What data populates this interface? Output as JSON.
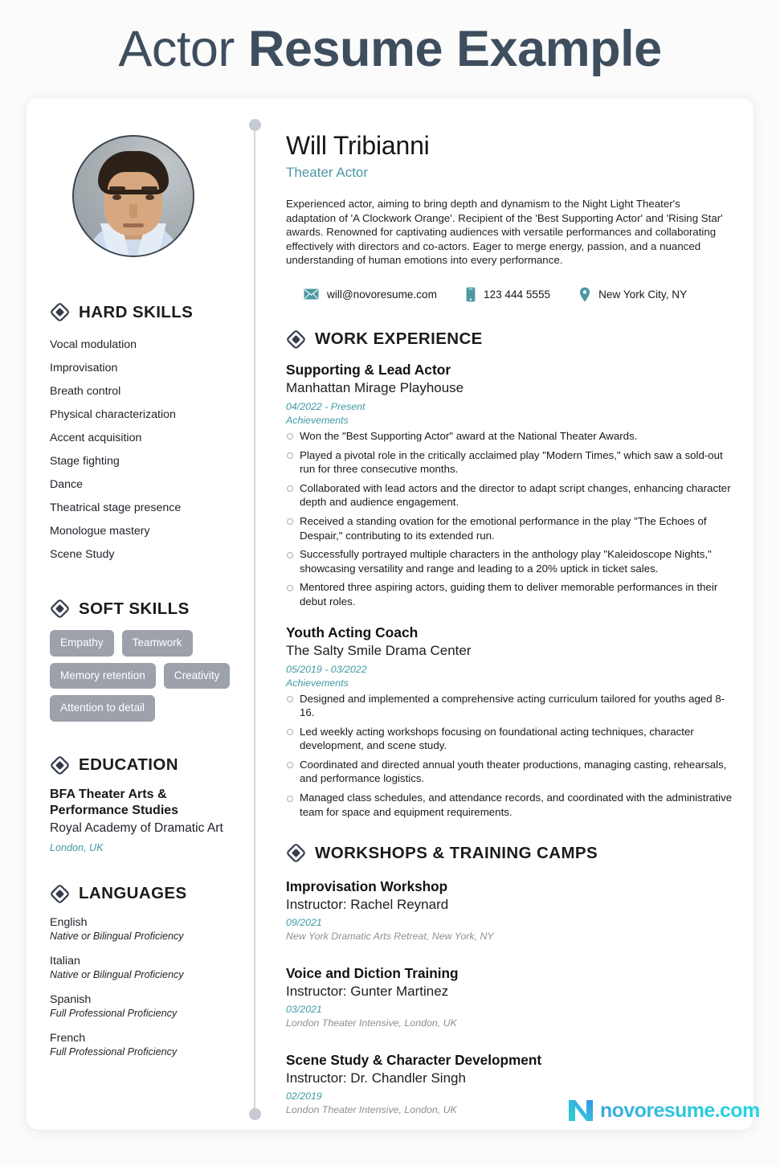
{
  "header": {
    "title_light": "Actor",
    "title_bold": "Resume Example"
  },
  "profile": {
    "name": "Will Tribianni",
    "role": "Theater Actor",
    "summary": "Experienced actor, aiming to bring depth and dynamism to the Night Light Theater's adaptation of 'A Clockwork Orange'. Recipient of the 'Best Supporting Actor' and 'Rising Star' awards. Renowned for captivating audiences with versatile performances and collaborating effectively with directors and co-actors. Eager to merge energy, passion, and a nuanced understanding of human emotions into every performance.",
    "photo_alt": "portrait-photo"
  },
  "contacts": [
    {
      "icon": "envelope-icon",
      "text": "will@novoresume.com"
    },
    {
      "icon": "phone-icon",
      "text": "123 444 5555"
    },
    {
      "icon": "location-pin-icon",
      "text": "New York City, NY"
    }
  ],
  "sidebar": {
    "hard_skills": {
      "heading": "HARD SKILLS",
      "items": [
        "Vocal modulation",
        "Improvisation",
        "Breath control",
        "Physical characterization",
        "Accent acquisition",
        "Stage fighting",
        "Dance",
        "Theatrical stage presence",
        "Monologue mastery",
        "Scene Study"
      ]
    },
    "soft_skills": {
      "heading": "SOFT SKILLS",
      "items": [
        "Empathy",
        "Teamwork",
        "Memory retention",
        "Creativity",
        "Attention to detail"
      ]
    },
    "education": {
      "heading": "EDUCATION",
      "degree": "BFA Theater Arts & Performance Studies",
      "school": "Royal Academy of Dramatic Art",
      "location": "London, UK"
    },
    "languages": {
      "heading": "LANGUAGES",
      "items": [
        {
          "name": "English",
          "level": "Native or Bilingual Proficiency"
        },
        {
          "name": "Italian",
          "level": "Native or Bilingual Proficiency"
        },
        {
          "name": "Spanish",
          "level": "Full Professional Proficiency"
        },
        {
          "name": "French",
          "level": "Full Professional Proficiency"
        }
      ]
    }
  },
  "work": {
    "heading": "WORK EXPERIENCE",
    "achievements_label": "Achievements",
    "jobs": [
      {
        "title": "Supporting & Lead Actor",
        "org": "Manhattan Mirage Playhouse",
        "date": "04/2022 - Present",
        "bullets": [
          "Won the \"Best Supporting Actor\" award at the National Theater Awards.",
          "Played a pivotal role in the critically acclaimed play \"Modern Times,\" which saw a sold-out run for three consecutive months.",
          "Collaborated with lead actors and the director to adapt script changes, enhancing character depth and audience engagement.",
          "Received a standing ovation for the emotional performance in the play \"The Echoes of Despair,\" contributing to its extended run.",
          "Successfully portrayed multiple characters in the anthology play \"Kaleidoscope Nights,\" showcasing versatility and range and leading to a 20% uptick in ticket sales.",
          "Mentored three aspiring actors, guiding them to deliver memorable performances in their debut roles."
        ]
      },
      {
        "title": "Youth Acting Coach",
        "org": "The Salty Smile Drama Center",
        "date": "05/2019 - 03/2022",
        "bullets": [
          "Designed and implemented a comprehensive acting curriculum tailored for youths aged 8-16.",
          "Led weekly acting workshops focusing on foundational acting techniques, character development, and scene study.",
          "Coordinated and directed annual youth theater productions, managing casting, rehearsals, and performance logistics.",
          "Managed class schedules, and attendance records, and coordinated with the administrative team for space and equipment requirements."
        ]
      }
    ]
  },
  "workshops": {
    "heading": "WORKSHOPS & TRAINING CAMPS",
    "items": [
      {
        "title": "Improvisation Workshop",
        "instructor": "Instructor: Rachel Reynard",
        "date": "09/2021",
        "venue": "New York Dramatic Arts Retreat, New York, NY"
      },
      {
        "title": "Voice and Diction Training",
        "instructor": "Instructor: Gunter Martinez",
        "date": "03/2021",
        "venue": "London Theater Intensive, London, UK"
      },
      {
        "title": "Scene Study & Character Development",
        "instructor": "Instructor: Dr. Chandler Singh",
        "date": "02/2019",
        "venue": "London Theater Intensive, London, UK"
      }
    ]
  },
  "branding": {
    "logo_text": "novoresume.com",
    "logo_mark": "N"
  },
  "colors": {
    "title": "#3e4e5e",
    "teal": "#4d98a3",
    "accent_italic": "#3f9aa5",
    "pill_bg": "#9ca1aa",
    "icon_dark": "#333c4b",
    "venue_gray": "#8b8f96"
  }
}
